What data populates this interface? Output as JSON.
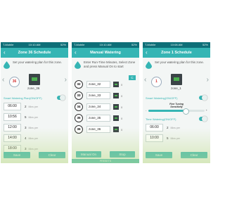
{
  "status_bar": {
    "carrier": "T-Mobile",
    "battery": "52%"
  },
  "screens": {
    "left": {
      "time": "10:10 AM",
      "title": "Zone 36 Schedule",
      "instruction": "Set your watering plan for this zone.",
      "zone_number": "36",
      "zone_name": "zone_36",
      "toggle_label": "Smart Watering Plan(ON/OFF)",
      "times": [
        {
          "time": "06:00",
          "minutes": "2",
          "unit": "Mins per"
        },
        {
          "time": "10:56",
          "minutes": "5",
          "unit": "Mins per"
        },
        {
          "time": "12:00",
          "minutes": "3",
          "unit": "Mins per"
        },
        {
          "time": "14:00",
          "minutes": "4",
          "unit": "Mins per"
        },
        {
          "time": "18:00",
          "minutes": "3",
          "unit": "Mins per"
        }
      ],
      "save": "Save",
      "clear": "Clear"
    },
    "mid": {
      "time": "10:10 AM",
      "title": "Manual Watering",
      "instruction": "Enter Run-Time Minutes, Select Zone and press Manual On to start",
      "c_label": "C",
      "rows": [
        {
          "num": "32",
          "zone": "zone_32",
          "value": "0",
          "mins": "0"
        },
        {
          "num": "33",
          "zone": "zone_33",
          "value": "0",
          "mins": "0"
        },
        {
          "num": "34",
          "zone": "zone_34",
          "value": "0",
          "mins": "0"
        },
        {
          "num": "35",
          "zone": "zone_35",
          "value": "0",
          "mins": "0"
        },
        {
          "num": "36",
          "zone": "zone_36",
          "value": "0",
          "mins": "0"
        }
      ],
      "manual_on": "Manual On",
      "stop": "Stop",
      "presets": "PRESETS"
    },
    "right": {
      "time": "10:08 AM",
      "title": "Zone 1 Schedule",
      "instruction": "Set your watering plan for this zone.",
      "zone_number": "1",
      "zone_name": "zone_1",
      "toggle_label": "Smart Watering(ON/OFF)",
      "slider_title": "Fine Tuning",
      "slider_sub": "Sensitivity",
      "slider_value": 0.65,
      "toggle2_label": "Time Watering(ON/OFF)",
      "times": [
        {
          "time": "06:00",
          "minutes": "2",
          "unit": "Mins per"
        },
        {
          "time": "10:00",
          "minutes": "5",
          "unit": "Mins per"
        }
      ],
      "save": "Save",
      "clear": "Clear"
    }
  }
}
